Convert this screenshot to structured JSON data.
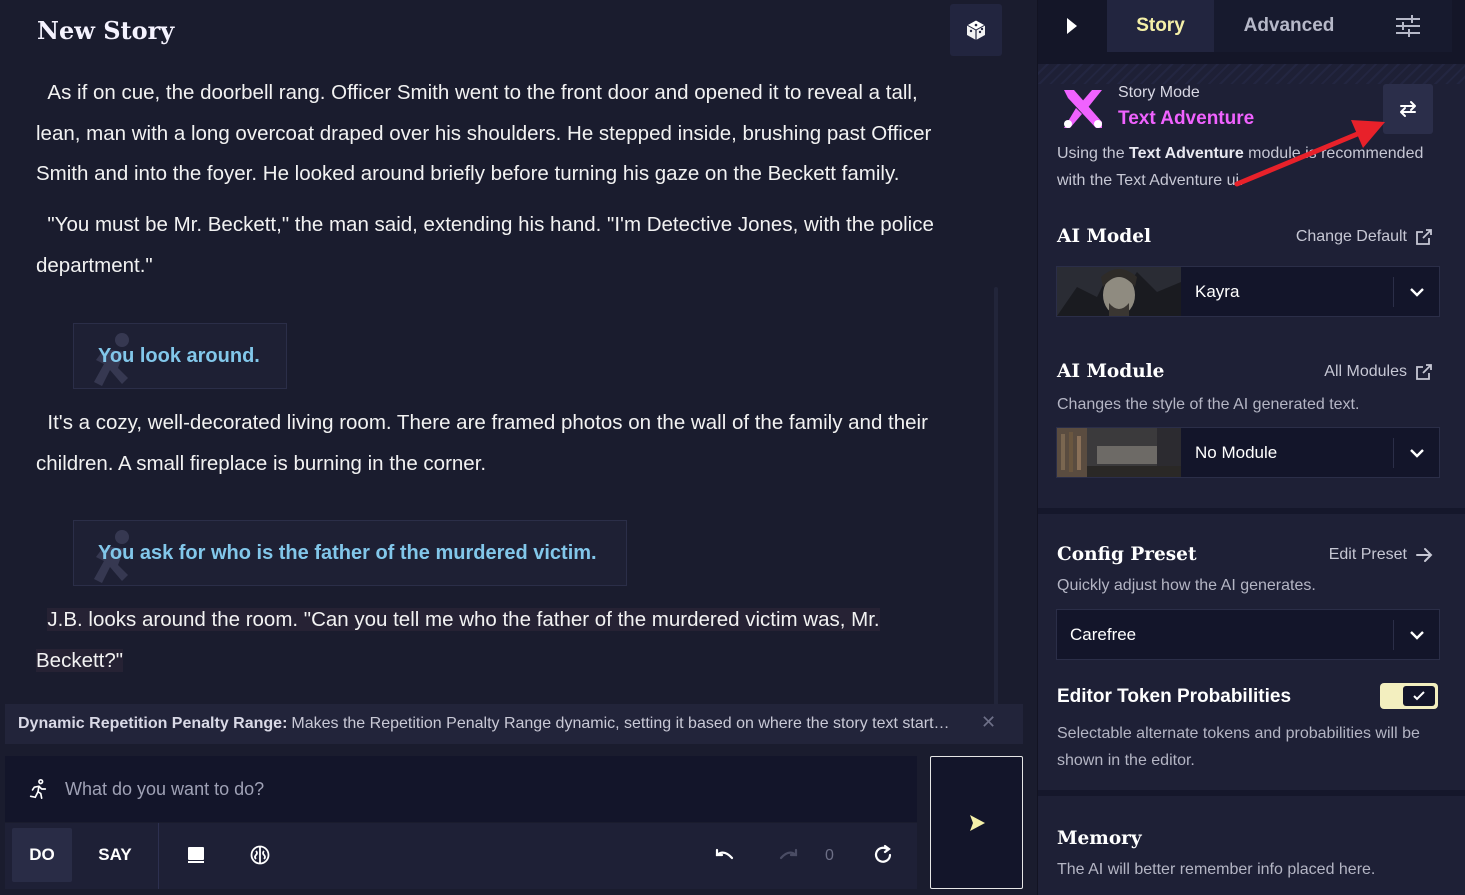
{
  "story": {
    "title": "New Story",
    "paragraphs": [
      "As if on cue, the doorbell rang. Officer Smith went to the front door and opened it to reveal a tall, lean, man with a long overcoat draped over his shoulders. He stepped inside, brushing past Officer Smith and into the foyer. He looked around briefly before turning his gaze on the Beckett family.",
      "\"You must be Mr. Beckett,\" the man said, extending his hand. \"I'm Detective Jones, with the police department.\"",
      "It's a cozy, well-decorated living room. There are framed photos on the wall of the family and their children. A small fireplace is burning in the corner.",
      "J.B. looks around the room. \"Can you tell me who the father of the murdered victim was, Mr. Beckett?\""
    ],
    "actions": [
      "You look around.",
      "You ask for who is the father of the murdered victim."
    ]
  },
  "tip": {
    "label": "Dynamic Repetition Penalty Range:",
    "text": "Makes the Repetition Penalty Range dynamic, setting it based on where the story text start…"
  },
  "input": {
    "placeholder": "What do you want to do?"
  },
  "toolbar": {
    "do_label": "DO",
    "say_label": "SAY",
    "retry_count": "0"
  },
  "sidebar": {
    "tabs": {
      "story": "Story",
      "advanced": "Advanced"
    },
    "story_mode": {
      "small_label": "Story Mode",
      "name": "Text Adventure",
      "desc_prefix": "Using the ",
      "desc_bold": "Text Adventure",
      "desc_suffix": " module is recommended with the Text Adventure ui."
    },
    "ai_model": {
      "title": "AI Model",
      "link": "Change Default",
      "value": "Kayra"
    },
    "ai_module": {
      "title": "AI Module",
      "link": "All Modules",
      "desc": "Changes the style of the AI generated text.",
      "value": "No Module"
    },
    "config_preset": {
      "title": "Config Preset",
      "link": "Edit Preset",
      "desc": "Quickly adjust how the AI generates.",
      "value": "Carefree"
    },
    "token_probs": {
      "title": "Editor Token Probabilities",
      "desc": "Selectable alternate tokens and probabilities will be shown in the editor.",
      "enabled": true
    },
    "memory": {
      "title": "Memory",
      "desc": "The AI will better remember info placed here."
    }
  },
  "colors": {
    "background": "#1a1c2e",
    "accent_yellow": "#f5f0a8",
    "accent_magenta": "#f062ff",
    "action_text": "#82c7ea",
    "annotation_arrow": "#e8212a"
  },
  "icons": [
    "dice-icon",
    "running-person-icon",
    "send-icon",
    "book-icon",
    "brain-icon",
    "undo-icon",
    "redo-icon",
    "retry-icon",
    "play-icon",
    "sliders-icon",
    "swap-icon",
    "external-link-icon",
    "arrow-right-icon",
    "chevron-down-icon",
    "check-icon"
  ]
}
